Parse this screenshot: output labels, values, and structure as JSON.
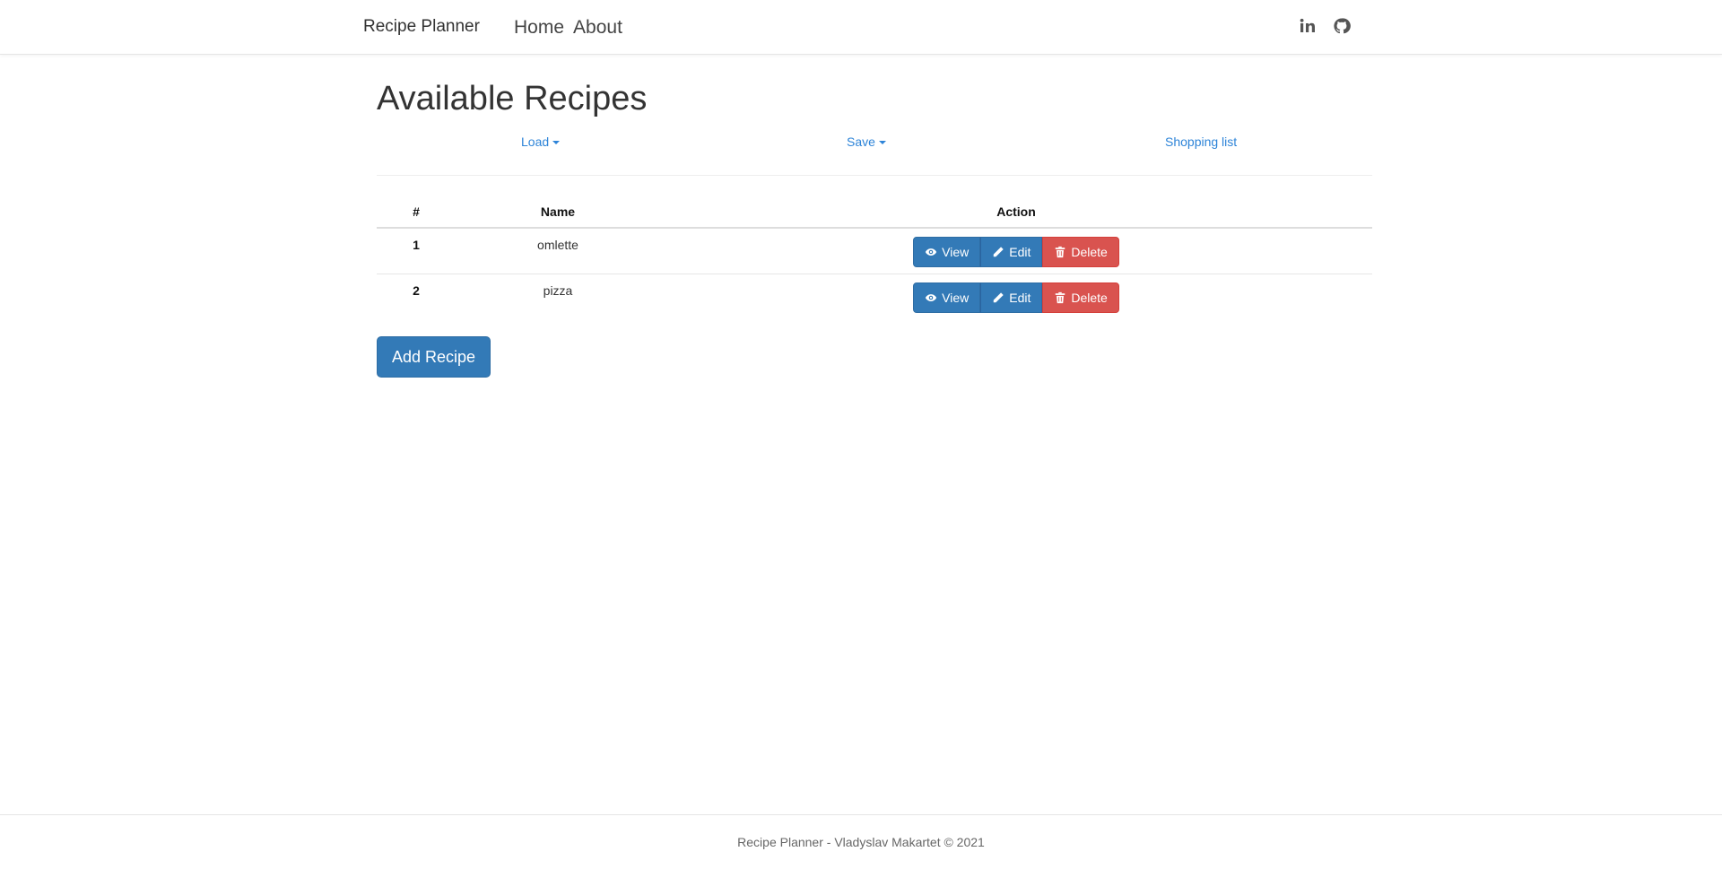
{
  "navbar": {
    "brand": "Recipe Planner",
    "links": [
      {
        "label": "Home"
      },
      {
        "label": "About"
      }
    ],
    "social": [
      {
        "icon": "linkedin-icon"
      },
      {
        "icon": "github-icon"
      }
    ]
  },
  "page": {
    "title": "Available Recipes"
  },
  "toolbar": {
    "load_label": "Load",
    "save_label": "Save",
    "shopping_label": "Shopping list"
  },
  "table": {
    "headers": {
      "num": "#",
      "name": "Name",
      "action": "Action"
    },
    "rows": [
      {
        "num": "1",
        "name": "omlette"
      },
      {
        "num": "2",
        "name": "pizza"
      }
    ],
    "actions": {
      "view": "View",
      "edit": "Edit",
      "delete": "Delete"
    }
  },
  "add_button": "Add Recipe",
  "footer": {
    "text": "Recipe Planner - Vladyslav Makartet © 2021"
  },
  "colors": {
    "primary": "#337ab7",
    "danger": "#d9534f",
    "link": "#2d84d8"
  }
}
